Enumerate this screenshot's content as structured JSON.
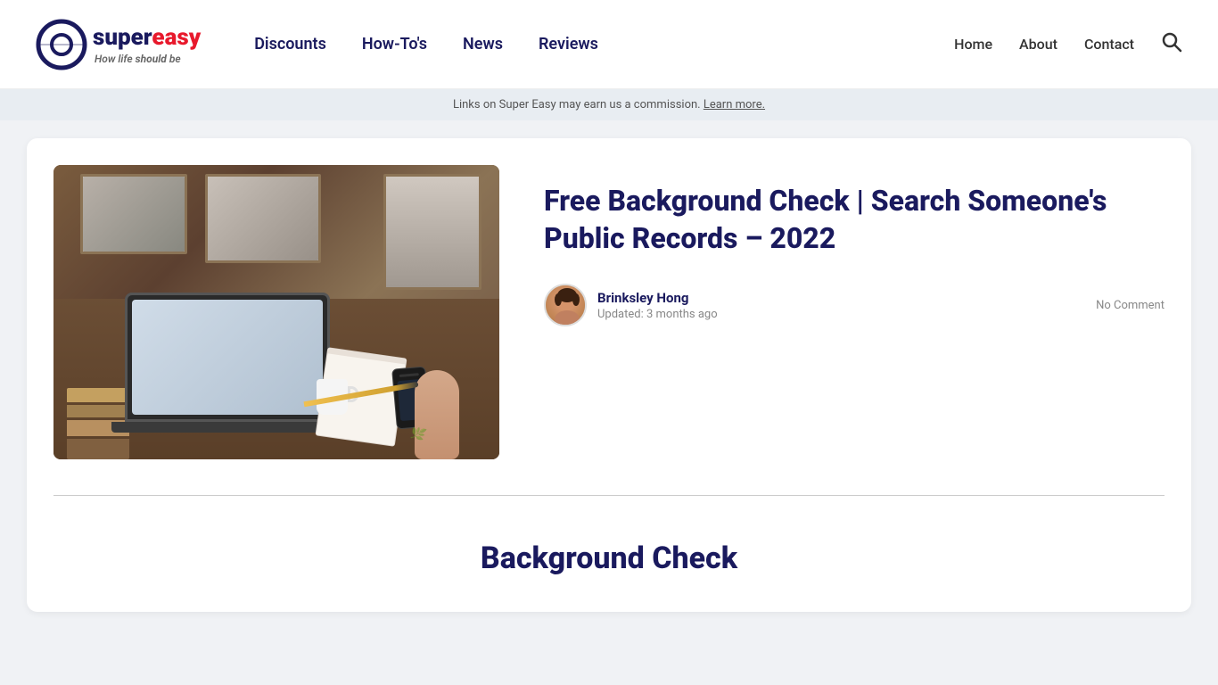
{
  "header": {
    "logo": {
      "brand_super": "super",
      "brand_easy": "easy",
      "tagline_prefix": "How life ",
      "tagline_emphasis": "should",
      "tagline_suffix": " be"
    },
    "main_nav": [
      {
        "label": "Discounts",
        "id": "discounts"
      },
      {
        "label": "How-To's",
        "id": "howtos"
      },
      {
        "label": "News",
        "id": "news"
      },
      {
        "label": "Reviews",
        "id": "reviews"
      }
    ],
    "secondary_nav": [
      {
        "label": "Home",
        "id": "home"
      },
      {
        "label": "About",
        "id": "about"
      },
      {
        "label": "Contact",
        "id": "contact"
      }
    ],
    "search_aria": "Search"
  },
  "commission_bar": {
    "text": "Links on Super Easy may earn us a commission.",
    "link_text": "Learn more."
  },
  "article": {
    "title": "Free Background Check | Search Someone's Public Records – 2022",
    "author_name": "Brinksley Hong",
    "updated": "Updated: 3 months ago",
    "no_comment": "No Comment"
  },
  "section": {
    "title": "Background Check"
  },
  "icons": {
    "search": "🔍"
  }
}
